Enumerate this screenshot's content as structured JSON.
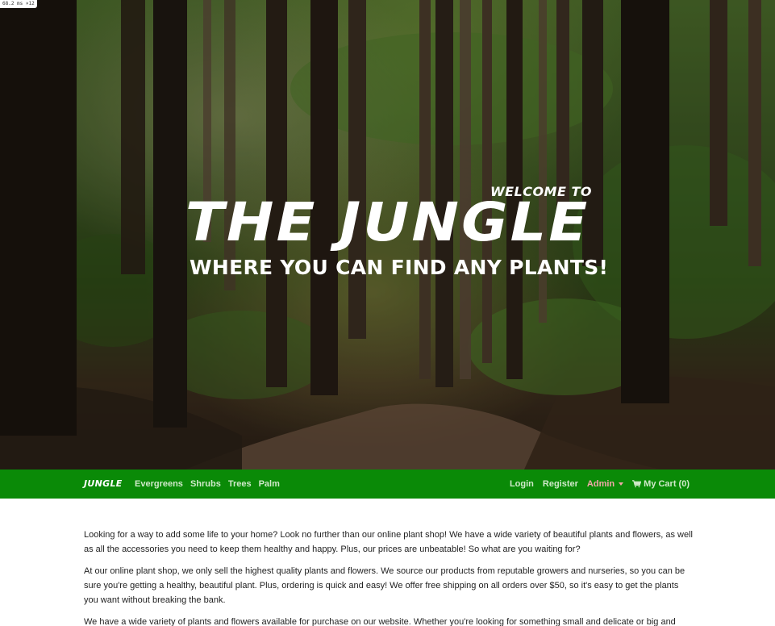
{
  "debug": {
    "label": "68.2 ms ×12"
  },
  "hero": {
    "welcome": "WELCOME TO",
    "title": "THE JUNGLE",
    "subtitle": "WHERE YOU CAN FIND ANY PLANTS!"
  },
  "navbar": {
    "brand": "JUNGLE",
    "left_links": [
      "Evergreens",
      "Shrubs",
      "Trees",
      "Palm"
    ],
    "login": "Login",
    "register": "Register",
    "admin": "Admin",
    "cart": "My Cart (0)",
    "colors": {
      "background": "#0a8a07",
      "link": "#cfe9c9",
      "admin": "#f0a8a8"
    }
  },
  "content": {
    "paragraphs": [
      "Looking for a way to add some life to your home? Look no further than our online plant shop! We have a wide variety of beautiful plants and flowers, as well as all the accessories you need to keep them healthy and happy. Plus, our prices are unbeatable! So what are you waiting for?",
      "At our online plant shop, we only sell the highest quality plants and flowers. We source our products from reputable growers and nurseries, so you can be sure you're getting a healthy, beautiful plant. Plus, ordering is quick and easy! We offer free shipping on all orders over $50, so it's easy to get the plants you want without breaking the bank.",
      "We have a wide variety of plants and flowers available for purchase on our website. Whether you're looking for something small and delicate or big and"
    ]
  }
}
